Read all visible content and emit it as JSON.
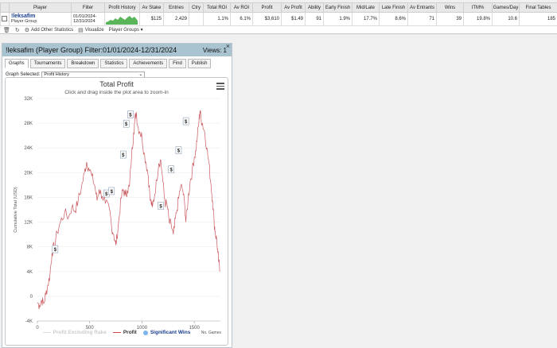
{
  "table": {
    "headers": [
      "",
      "Player",
      "Filter",
      "Profit History",
      "Av Stake",
      "Entries",
      "Ctry",
      "Total ROI",
      "Av ROI",
      "Profit",
      "Av Profit",
      "Ability",
      "Early Finish",
      "Mid/Late",
      "Late Finish",
      "Av Entrants",
      "Wins",
      "ITM%",
      "Games/Day",
      "Final Tables"
    ],
    "row": {
      "player_name": "!leksafim",
      "player_group": "Player Group",
      "filter_line1": "01/01/2024-",
      "filter_line2": "12/31/2024",
      "av_stake": "$125",
      "entries": "2,429",
      "ctry": "",
      "total_roi": "1.1%",
      "av_roi": "6.1%",
      "profit": "$3,610",
      "av_profit": "$1.49",
      "ability": "91",
      "early_finish": "1.9%",
      "mid_late": "17.7%",
      "late_finish": "8.6%",
      "av_entrants": "71",
      "wins": "39",
      "itm": "19.8%",
      "games_day": "10.6",
      "final_tables": "185"
    }
  },
  "toolbar": {
    "add_stats": "Add Other Statistics",
    "visualize": "Visualize",
    "player_groups": "Player Groups ▾"
  },
  "panel": {
    "title": "!leksafim (Player Group) Filter:01/01/2024-12/31/2024",
    "views": "Views: 1",
    "close": "×",
    "tabs": [
      "Graphs",
      "Tournaments",
      "Breakdown",
      "Statistics",
      "Achievements",
      "Find",
      "Publish"
    ],
    "graph_selected_label": "Graph Selected:",
    "graph_selected_value": "Profit History"
  },
  "chart_data": {
    "type": "line",
    "title": "Total Profit",
    "subtitle": "Click and drag inside the plot area to zoom-in",
    "ylabel": "Cumulative Total (USD)",
    "xlabel": "No. Games",
    "ylim": [
      -4000,
      32000
    ],
    "xlim": [
      0,
      1750
    ],
    "y_ticks": [
      "-4K",
      "0",
      "4K",
      "8K",
      "12K",
      "16K",
      "20K",
      "24K",
      "28K",
      "32K"
    ],
    "x_ticks": [
      "0",
      "500",
      "1000",
      "1500"
    ],
    "legend": [
      "Profit Excluding Rake",
      "Profit",
      "Significant Wins"
    ],
    "series": [
      {
        "name": "Profit",
        "color": "#c9595f",
        "points": [
          [
            0,
            -1000
          ],
          [
            20,
            -1500
          ],
          [
            40,
            -600
          ],
          [
            60,
            -1200
          ],
          [
            80,
            300
          ],
          [
            100,
            1800
          ],
          [
            120,
            3500
          ],
          [
            140,
            7000
          ],
          [
            160,
            8200
          ],
          [
            190,
            10300
          ],
          [
            220,
            12000
          ],
          [
            260,
            13500
          ],
          [
            300,
            12800
          ],
          [
            330,
            14500
          ],
          [
            360,
            13800
          ],
          [
            390,
            15500
          ],
          [
            420,
            17500
          ],
          [
            450,
            20000
          ],
          [
            470,
            21700
          ],
          [
            490,
            20800
          ],
          [
            520,
            19500
          ],
          [
            550,
            17800
          ],
          [
            570,
            15500
          ],
          [
            590,
            17300
          ],
          [
            620,
            16200
          ],
          [
            650,
            15000
          ],
          [
            690,
            14000
          ],
          [
            710,
            11200
          ],
          [
            730,
            10000
          ],
          [
            750,
            8300
          ],
          [
            760,
            9500
          ],
          [
            780,
            12500
          ],
          [
            800,
            15800
          ],
          [
            820,
            17300
          ],
          [
            840,
            16400
          ],
          [
            860,
            17100
          ],
          [
            880,
            17800
          ],
          [
            900,
            22500
          ],
          [
            920,
            26500
          ],
          [
            930,
            28200
          ],
          [
            945,
            29800
          ],
          [
            960,
            27500
          ],
          [
            980,
            26600
          ],
          [
            1000,
            25800
          ],
          [
            1020,
            23200
          ],
          [
            1040,
            21500
          ],
          [
            1060,
            19500
          ],
          [
            1080,
            15500
          ],
          [
            1100,
            14400
          ],
          [
            1120,
            16200
          ],
          [
            1140,
            18800
          ],
          [
            1160,
            21500
          ],
          [
            1180,
            22000
          ],
          [
            1200,
            18500
          ],
          [
            1220,
            15200
          ],
          [
            1240,
            14800
          ],
          [
            1260,
            12000
          ],
          [
            1280,
            11500
          ],
          [
            1300,
            10000
          ],
          [
            1310,
            11200
          ],
          [
            1330,
            13500
          ],
          [
            1350,
            15800
          ],
          [
            1370,
            17800
          ],
          [
            1390,
            17200
          ],
          [
            1410,
            14500
          ],
          [
            1420,
            12000
          ],
          [
            1440,
            15500
          ],
          [
            1460,
            18500
          ],
          [
            1480,
            20200
          ],
          [
            1500,
            22500
          ],
          [
            1515,
            23500
          ],
          [
            1530,
            26000
          ],
          [
            1545,
            28500
          ],
          [
            1555,
            30000
          ],
          [
            1565,
            28800
          ],
          [
            1580,
            27800
          ],
          [
            1600,
            26500
          ],
          [
            1620,
            24000
          ],
          [
            1640,
            21500
          ],
          [
            1660,
            18000
          ],
          [
            1675,
            15500
          ],
          [
            1690,
            12000
          ],
          [
            1700,
            10500
          ],
          [
            1715,
            9000
          ],
          [
            1725,
            7000
          ],
          [
            1735,
            5500
          ],
          [
            1745,
            4000
          ]
        ]
      }
    ],
    "significant_wins": [
      [
        170,
        7500
      ],
      [
        660,
        16500
      ],
      [
        710,
        16900
      ],
      [
        820,
        22800
      ],
      [
        850,
        27800
      ],
      [
        890,
        29300
      ],
      [
        1180,
        14500
      ],
      [
        1280,
        20400
      ],
      [
        1350,
        23500
      ],
      [
        1420,
        28200
      ]
    ]
  }
}
